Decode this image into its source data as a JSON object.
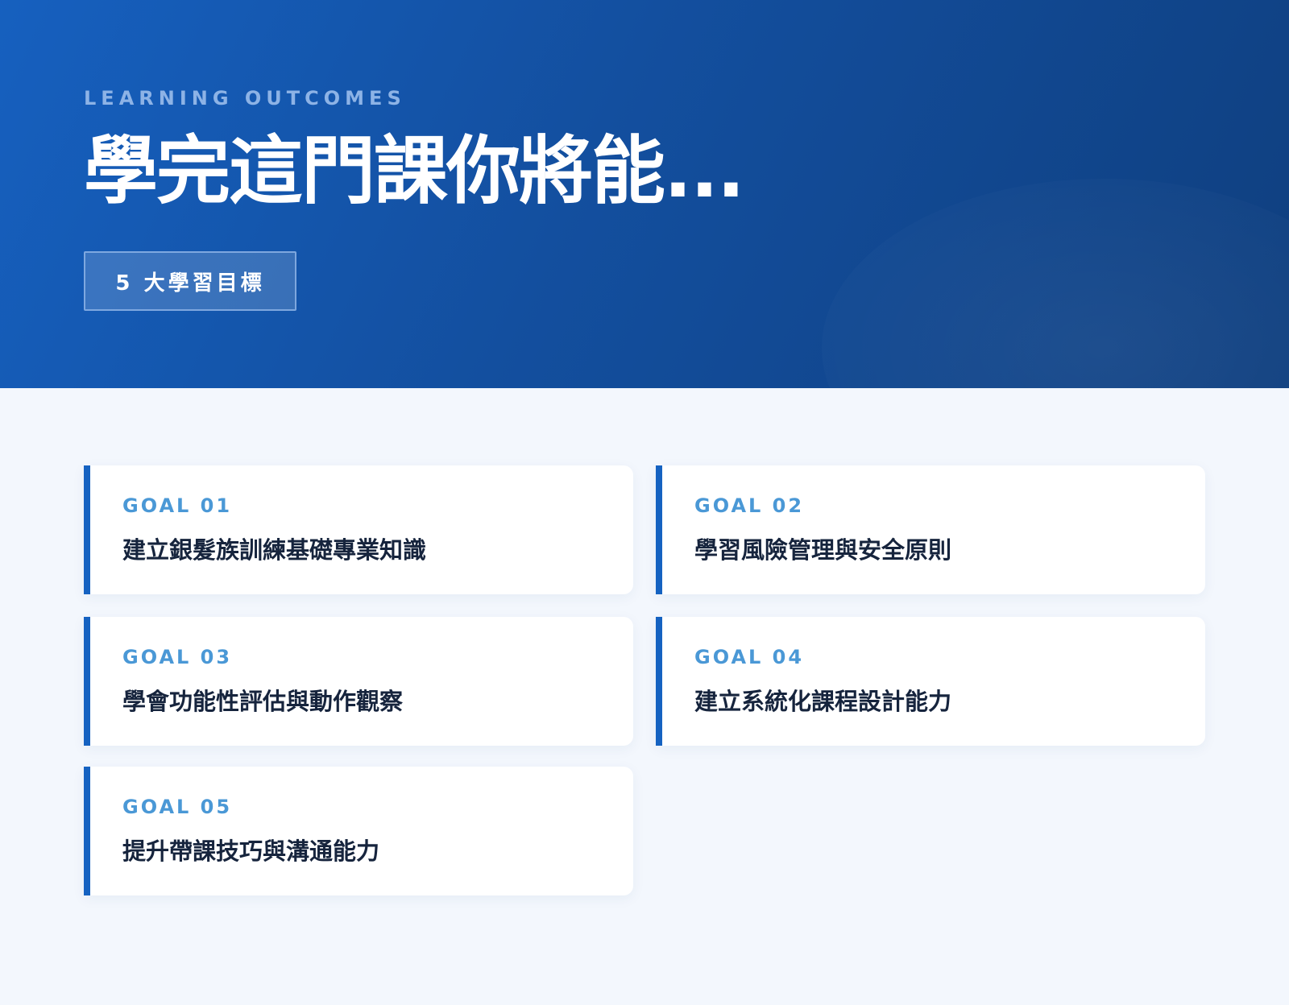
{
  "hero": {
    "eyebrow": "LEARNING OUTCOMES",
    "title": "學完這門課你將能...",
    "badge": "5 大學習目標"
  },
  "goals": [
    {
      "label": "GOAL 01",
      "text": "建立銀髮族訓練基礎專業知識"
    },
    {
      "label": "GOAL 02",
      "text": "學習風險管理與安全原則"
    },
    {
      "label": "GOAL 03",
      "text": "學會功能性評估與動作觀察"
    },
    {
      "label": "GOAL 04",
      "text": "建立系統化課程設計能力"
    },
    {
      "label": "GOAL 05",
      "text": "提升帶課技巧與溝通能力"
    }
  ],
  "colors": {
    "hero_start": "#1660bf",
    "hero_end": "#0f3f7f",
    "accent": "#1562c1",
    "goal_label": "#4a98d6",
    "goal_text": "#16243d",
    "page_bg": "#f3f7fd"
  }
}
